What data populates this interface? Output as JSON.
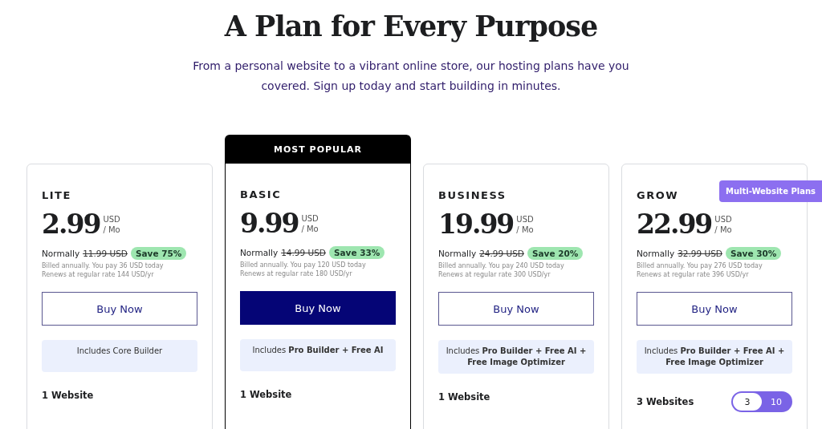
{
  "heading": "A Plan for Every Purpose",
  "subheading": "From a personal website to a vibrant online store, our hosting plans have you covered. Sign up today and start building in minutes.",
  "plans": [
    {
      "name": "LITE",
      "featured": false,
      "price": "2.99",
      "currency": "USD",
      "period": "/ Mo",
      "normally_label": "Normally",
      "old_price": "11.99 USD",
      "save": "Save 75%",
      "billed": "Billed annually. You pay 36 USD today",
      "renews": "Renews at regular rate 144 USD/yr",
      "button": "Buy Now",
      "includes": "Includes Core Builder",
      "websites": "1 Website"
    },
    {
      "name": "BASIC",
      "featured": true,
      "banner": "MOST POPULAR",
      "price": "9.99",
      "currency": "USD",
      "period": "/ Mo",
      "normally_label": "Normally",
      "old_price": "14.99 USD",
      "save": "Save 33%",
      "billed": "Billed annually. You pay 120 USD today",
      "renews": "Renews at regular rate 180 USD/yr",
      "button": "Buy Now",
      "includes": "Includes **Pro Builder + Free AI**",
      "websites": "1 Website"
    },
    {
      "name": "BUSINESS",
      "featured": false,
      "price": "19.99",
      "currency": "USD",
      "period": "/ Mo",
      "normally_label": "Normally",
      "old_price": "24.99 USD",
      "save": "Save 20%",
      "billed": "Billed annually. You pay 240 USD today",
      "renews": "Renews at regular rate 300 USD/yr",
      "button": "Buy Now",
      "includes": "Includes **Pro Builder + Free AI + Free Image Optimizer**",
      "websites": "1 Website"
    },
    {
      "name": "GROW",
      "featured": false,
      "tag": "Multi-Website Plans",
      "price": "22.99",
      "currency": "USD",
      "period": "/ Mo",
      "normally_label": "Normally",
      "old_price": "32.99 USD",
      "save": "Save 30%",
      "billed": "Billed annually. You pay 276 USD today",
      "renews": "Renews at regular rate 396 USD/yr",
      "button": "Buy Now",
      "includes": "Includes **Pro Builder + Free AI + Free Image Optimizer**",
      "websites": "3 Websites",
      "site_options": [
        {
          "label": "3",
          "selected": true
        },
        {
          "label": "10",
          "selected": false
        }
      ]
    }
  ]
}
